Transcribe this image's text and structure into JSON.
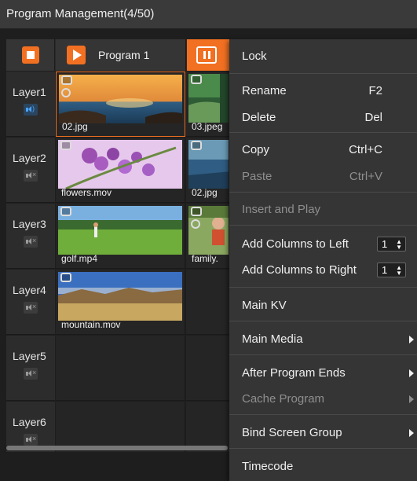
{
  "window": {
    "title": "Program Management(4/50)"
  },
  "programs": [
    {
      "label": "",
      "icon": "stop-icon"
    },
    {
      "label": "Program 1",
      "icon": "play-icon"
    },
    {
      "label": "",
      "icon": "pause-icon",
      "active_color": "#f27022"
    }
  ],
  "layers": [
    {
      "name": "Layer1",
      "audio": "speaker-on-icon"
    },
    {
      "name": "Layer2",
      "audio": "speaker-muted-icon"
    },
    {
      "name": "Layer3",
      "audio": "speaker-muted-icon"
    },
    {
      "name": "Layer4",
      "audio": "speaker-muted-icon"
    },
    {
      "name": "Layer5",
      "audio": "speaker-muted-icon"
    },
    {
      "name": "Layer6",
      "audio": "speaker-muted-icon"
    }
  ],
  "media": {
    "l1c1": "02.jpg",
    "l1c2": "03.jpeg",
    "l2c1": "flowers.mov",
    "l2c2": "02.jpg",
    "l3c1": "golf.mp4",
    "l3c2": "family.",
    "l4c1": "mountain.mov"
  },
  "context_menu": {
    "lock": "Lock",
    "rename": "Rename",
    "rename_key": "F2",
    "delete": "Delete",
    "delete_key": "Del",
    "copy": "Copy",
    "copy_key": "Ctrl+C",
    "paste": "Paste",
    "paste_key": "Ctrl+V",
    "insert_play": "Insert and Play",
    "add_left": "Add Columns to Left",
    "add_left_value": "1",
    "add_right": "Add Columns to Right",
    "add_right_value": "1",
    "main_kv": "Main KV",
    "main_media": "Main Media",
    "after_program": "After Program Ends",
    "cache_program": "Cache Program",
    "bind_screen": "Bind Screen Group",
    "timecode": "Timecode"
  },
  "colors": {
    "accent": "#f27022",
    "background": "#1e1e1e",
    "menu": "#353535",
    "disabled_text": "#8e8e8e"
  }
}
